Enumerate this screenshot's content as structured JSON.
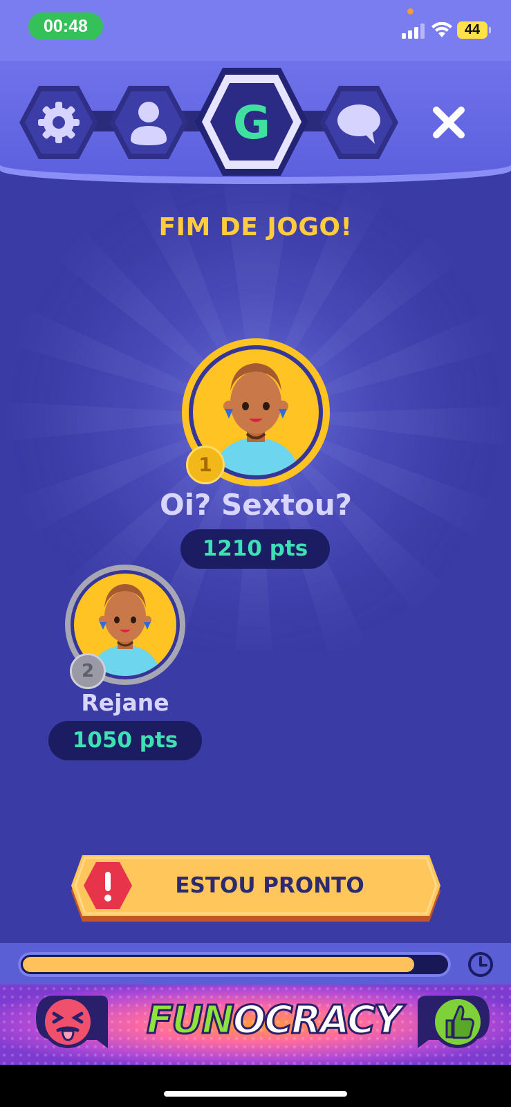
{
  "status_bar": {
    "time": "00:48",
    "battery": "44"
  },
  "nav": {
    "items": [
      {
        "name": "settings",
        "icon": "gear-icon"
      },
      {
        "name": "profile",
        "icon": "user-icon"
      },
      {
        "name": "game",
        "icon": "game-logo-icon",
        "letter": "G",
        "active": true
      },
      {
        "name": "chat",
        "icon": "chat-bubble-icon"
      }
    ],
    "close_icon": "close-icon"
  },
  "game_over": {
    "title": "FIM DE JOGO!"
  },
  "players": [
    {
      "rank": "1",
      "name": "Oi? Sextou?",
      "score": "1210 pts",
      "ring": "#ffc324"
    },
    {
      "rank": "2",
      "name": "Rejane",
      "score": "1050 pts",
      "ring": "#a7a7b4"
    }
  ],
  "ready_button": {
    "label": "ESTOU PRONTO",
    "icon": "alert-hexagon-icon"
  },
  "timer": {
    "progress": 0.925,
    "icon": "clock-icon"
  },
  "banner": {
    "brand_prefix": "FUN",
    "brand_suffix": "OCRACY",
    "left_icon": "tongue-out-face-icon",
    "right_icon": "thumbs-up-icon"
  },
  "colors": {
    "background": "#3b3ba6",
    "title": "#ffcc3d",
    "score_text": "#3fe0b3",
    "button": "#ffc65c",
    "accent_green": "#3fe0a0"
  }
}
